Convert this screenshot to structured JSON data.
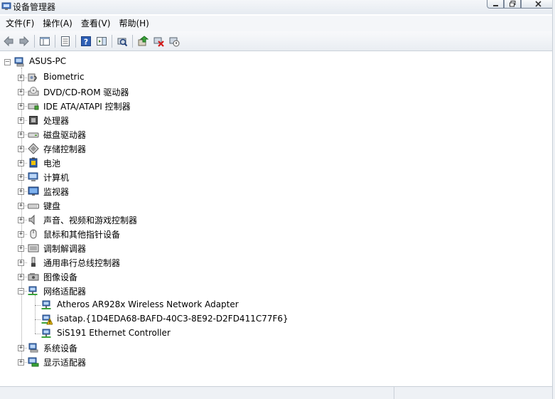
{
  "window": {
    "title": "设备管理器",
    "buttons": [
      "minimize",
      "maximize",
      "close"
    ]
  },
  "menu": {
    "items": [
      "文件(F)",
      "操作(A)",
      "查看(V)",
      "帮助(H)"
    ]
  },
  "toolbar": {
    "buttons": [
      "back",
      "forward",
      "show-hide-console-tree",
      "properties",
      "help",
      "action-pane",
      "scan-hardware",
      "update-driver",
      "uninstall",
      "disable"
    ]
  },
  "tree": {
    "root": "ASUS-PC",
    "categories": [
      {
        "label": "Biometric",
        "icon": "biometric-icon",
        "expanded": false
      },
      {
        "label": "DVD/CD-ROM 驱动器",
        "icon": "dvd-drive-icon",
        "expanded": false
      },
      {
        "label": "IDE ATA/ATAPI 控制器",
        "icon": "ide-controller-icon",
        "expanded": false
      },
      {
        "label": "处理器",
        "icon": "processor-icon",
        "expanded": false
      },
      {
        "label": "磁盘驱动器",
        "icon": "disk-drive-icon",
        "expanded": false
      },
      {
        "label": "存储控制器",
        "icon": "storage-controller-icon",
        "expanded": false
      },
      {
        "label": "电池",
        "icon": "battery-icon",
        "expanded": false
      },
      {
        "label": "计算机",
        "icon": "computer-icon",
        "expanded": false
      },
      {
        "label": "监视器",
        "icon": "monitor-icon",
        "expanded": false
      },
      {
        "label": "键盘",
        "icon": "keyboard-icon",
        "expanded": false
      },
      {
        "label": "声音、视频和游戏控制器",
        "icon": "sound-icon",
        "expanded": false
      },
      {
        "label": "鼠标和其他指针设备",
        "icon": "mouse-icon",
        "expanded": false
      },
      {
        "label": "调制解调器",
        "icon": "modem-icon",
        "expanded": false
      },
      {
        "label": "通用串行总线控制器",
        "icon": "usb-icon",
        "expanded": false
      },
      {
        "label": "图像设备",
        "icon": "imaging-icon",
        "expanded": false
      },
      {
        "label": "网络适配器",
        "icon": "network-adapter-icon",
        "expanded": true,
        "children": [
          {
            "label": "Atheros AR928x Wireless Network Adapter",
            "icon": "network-card-icon",
            "warning": false
          },
          {
            "label": "isatap.{1D4EDA68-BAFD-40C3-8E92-D2FD411C77F6}",
            "icon": "network-card-warning-icon",
            "warning": true
          },
          {
            "label": "SiS191 Ethernet Controller",
            "icon": "network-card-icon",
            "warning": false
          }
        ]
      },
      {
        "label": "系统设备",
        "icon": "system-device-icon",
        "expanded": false
      },
      {
        "label": "显示适配器",
        "icon": "display-adapter-icon",
        "expanded": false
      }
    ]
  },
  "colors": {
    "tree_line": "#a0a0a0",
    "warning": "#f2c200",
    "toolbar_bg": "#eef1f5"
  }
}
